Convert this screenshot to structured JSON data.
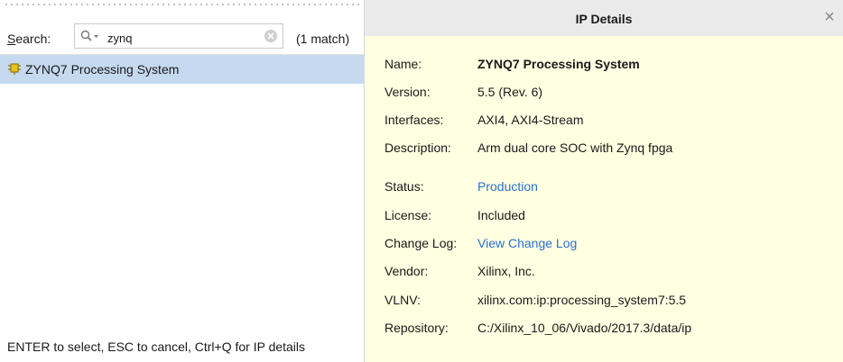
{
  "left": {
    "search_label_underlined": "S",
    "search_label_rest": "earch:",
    "search_value": "zynq",
    "match_count": "(1 match)",
    "results": [
      {
        "label": "ZYNQ7 Processing System"
      }
    ],
    "hint": "ENTER to select, ESC to cancel, Ctrl+Q for IP details"
  },
  "details": {
    "title": "IP Details",
    "close_symbol": "×",
    "rows": [
      {
        "label": "Name:",
        "value": "ZYNQ7 Processing System"
      },
      {
        "label": "Version:",
        "value": "5.5 (Rev. 6)"
      },
      {
        "label": "Interfaces:",
        "value": "AXI4, AXI4-Stream"
      },
      {
        "label": "Description:",
        "value": "Arm dual core SOC with Zynq fpga"
      },
      {
        "label": "Status:",
        "value": "Production"
      },
      {
        "label": "License:",
        "value": "Included"
      },
      {
        "label": "Change Log:",
        "value": "View Change Log"
      },
      {
        "label": "Vendor:",
        "value": "Xilinx, Inc."
      },
      {
        "label": "VLNV:",
        "value": "xilinx.com:ip:processing_system7:5.5"
      },
      {
        "label": "Repository:",
        "value": "C:/Xilinx_10_06/Vivado/2017.3/data/ip"
      }
    ]
  },
  "colors": {
    "selection": "#c5d9ef",
    "details_bg": "#ffffe1",
    "link": "#2a6fd6",
    "ip_icon": "#e8c21a"
  },
  "icons": [
    "search-icon",
    "clear-search-icon",
    "ip-core-icon",
    "close-icon"
  ]
}
